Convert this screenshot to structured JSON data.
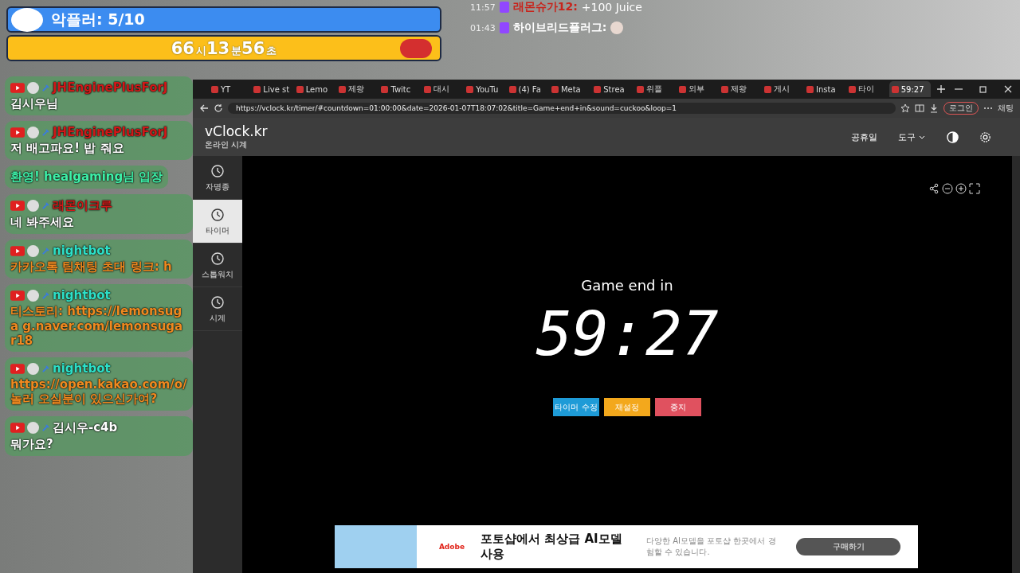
{
  "overlay": {
    "counter": "악플러: 5/10",
    "countdown": [
      {
        "value": "66",
        "unit": "시"
      },
      {
        "value": "13",
        "unit": "분"
      },
      {
        "value": "56",
        "unit": "초"
      }
    ]
  },
  "side_chat": [
    {
      "time": "11:57",
      "name": "래몬슈가12:",
      "text": "+100 Juice"
    },
    {
      "time": "01:43",
      "name": "하이브리드플러그:"
    }
  ],
  "chat": [
    {
      "kind": "user",
      "name": "JHEnginePlusForJ",
      "color": "#d01818",
      "text": "김시우님"
    },
    {
      "kind": "user",
      "name": "JHEnginePlusForJ",
      "color": "#d01818",
      "text": "저 배고파요! 밥 줘요"
    },
    {
      "kind": "system",
      "text": "환영! healgaming님 입장"
    },
    {
      "kind": "user",
      "name": "래몬이크루",
      "color": "#d01818",
      "text": "네 봐주세요"
    },
    {
      "kind": "bot",
      "name": "nightbot",
      "color": "#2de0c8",
      "text": "카카오톡 팀채팅 초대 링크: h"
    },
    {
      "kind": "bot",
      "name": "nightbot",
      "color": "#2de0c8",
      "text": "티스토리: https://lemonsuga g.naver.com/lemonsugar18"
    },
    {
      "kind": "bot",
      "name": "nightbot",
      "color": "#2de0c8",
      "text": "https://open.kakao.com/o/ 놀러 오실분이 있으신가여?"
    },
    {
      "kind": "user",
      "name": "김시우-c4b",
      "color": "#ffffff",
      "text": "뭐가요?"
    }
  ],
  "browser": {
    "tabs": [
      {
        "label": "YT",
        "selected": false
      },
      {
        "label": "Live st",
        "selected": false
      },
      {
        "label": "Lemo",
        "selected": false
      },
      {
        "label": "제왕",
        "selected": false
      },
      {
        "label": "Twitc",
        "selected": false
      },
      {
        "label": "대시",
        "selected": false
      },
      {
        "label": "YouTu",
        "selected": false
      },
      {
        "label": "(4) Fa",
        "selected": false
      },
      {
        "label": "Meta",
        "selected": false
      },
      {
        "label": "Strea",
        "selected": false
      },
      {
        "label": "위플",
        "selected": false
      },
      {
        "label": "외부",
        "selected": false
      },
      {
        "label": "제왕",
        "selected": false
      },
      {
        "label": "게시",
        "selected": false
      },
      {
        "label": "Insta",
        "selected": false
      },
      {
        "label": "타이",
        "selected": false
      },
      {
        "label": "59:27",
        "selected": true
      }
    ],
    "url": "https://vclock.kr/timer/#countdown=01:00:00&date=2026-01-07T18:07:02&title=Game+end+in&sound=cuckoo&loop=1",
    "login": "로그인",
    "copilot": "채팅"
  },
  "site": {
    "logo": "vClock.kr",
    "subtitle": "온라인 시계",
    "nav": [
      "공휴일",
      "도구"
    ],
    "sidebar": [
      {
        "label": "자명종",
        "selected": false
      },
      {
        "label": "타이머",
        "selected": true
      },
      {
        "label": "스톱워치",
        "selected": false
      },
      {
        "label": "시계",
        "selected": false
      }
    ],
    "timer_title": "Game end in",
    "time": "59:27",
    "buttons": [
      {
        "label": "타이머 수정",
        "color": "#1e9bd7"
      },
      {
        "label": "재설정",
        "color": "#f3a81c"
      },
      {
        "label": "중지",
        "color": "#e0515f"
      }
    ]
  },
  "ad": {
    "brand": "Adobe",
    "headline": "포토샵에서 최상급 AI모델 사용",
    "body": "다양한 AI모델을 포토샵 한곳에서 경험할 수 있습니다.",
    "button": "구매하기"
  }
}
